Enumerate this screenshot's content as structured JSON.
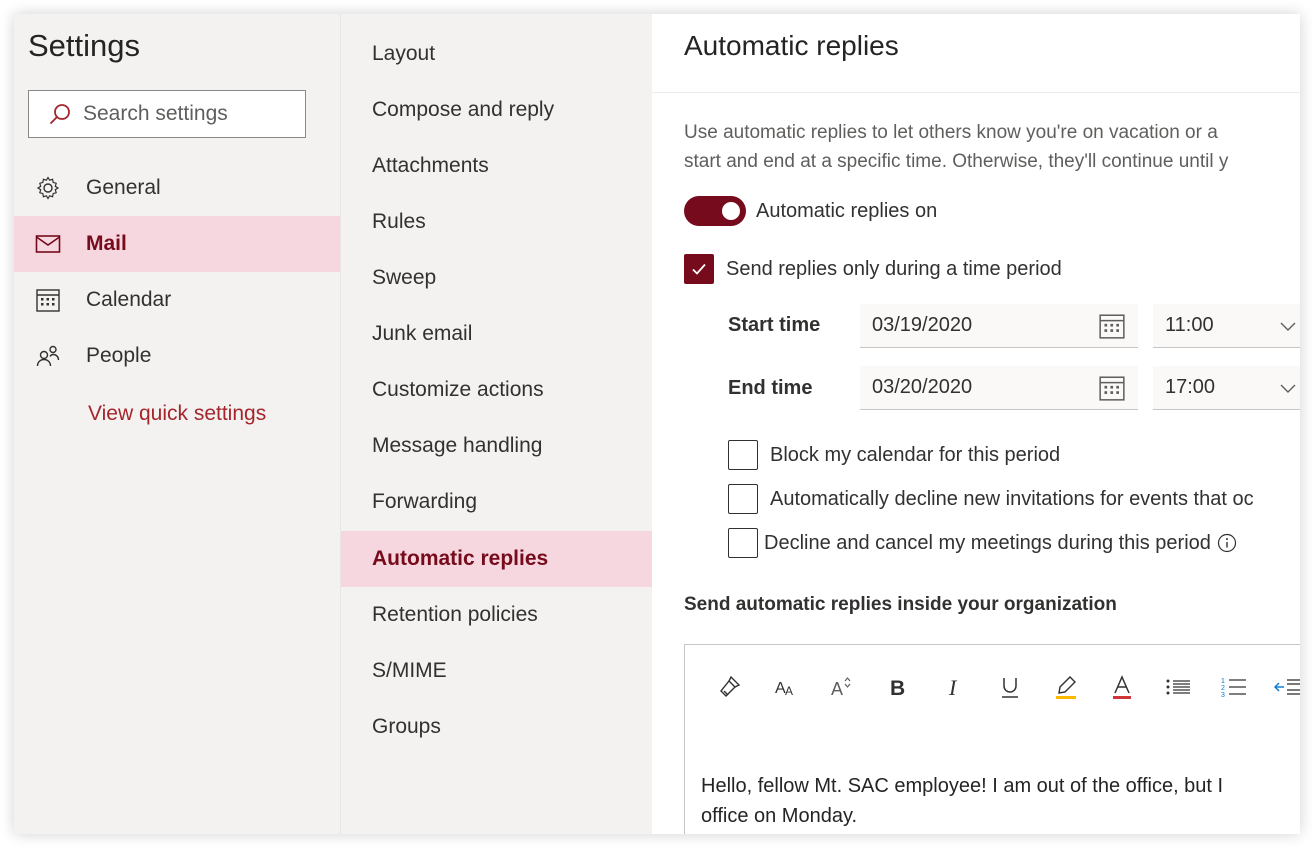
{
  "settings": {
    "title": "Settings",
    "search_placeholder": "Search settings",
    "nav": [
      {
        "label": "General",
        "icon": "gear-icon"
      },
      {
        "label": "Mail",
        "icon": "mail-icon",
        "active": true
      },
      {
        "label": "Calendar",
        "icon": "calendar-icon"
      },
      {
        "label": "People",
        "icon": "people-icon"
      }
    ],
    "quick_settings_link": "View quick settings"
  },
  "mail_menu": {
    "items": [
      "Layout",
      "Compose and reply",
      "Attachments",
      "Rules",
      "Sweep",
      "Junk email",
      "Customize actions",
      "Message handling",
      "Forwarding",
      "Automatic replies",
      "Retention policies",
      "S/MIME",
      "Groups"
    ],
    "active": "Automatic replies"
  },
  "auto_replies": {
    "title": "Automatic replies",
    "description_line1": "Use automatic replies to let others know you're on vacation or a",
    "description_line2": "start and end at a specific time. Otherwise, they'll continue until y",
    "toggle_label": "Automatic replies on",
    "toggle_on": true,
    "time_period_label": "Send replies only during a time period",
    "time_period_checked": true,
    "start_label": "Start time",
    "start_date": "03/19/2020",
    "start_time": "11:00",
    "end_label": "End time",
    "end_date": "03/20/2020",
    "end_time": "17:00",
    "options": [
      {
        "label": "Block my calendar for this period",
        "checked": false
      },
      {
        "label": "Automatically decline new invitations for events that oc",
        "checked": false
      },
      {
        "label": "Decline and cancel my meetings during this period",
        "checked": false
      }
    ],
    "inside_org_title": "Send automatic replies inside your organization",
    "toolbar_icons": [
      "format-painter-icon",
      "font-size-icon",
      "grow-font-icon",
      "bold-icon",
      "italic-icon",
      "underline-icon",
      "highlight-icon",
      "font-color-icon",
      "bullets-icon",
      "numbering-icon",
      "decrease-indent-icon"
    ],
    "message_line1": "Hello, fellow Mt. SAC employee! I am out of the office, but I",
    "message_line2": "office on Monday."
  },
  "colors": {
    "accent": "#750b1c",
    "active_bg": "#f6d7df",
    "pane_bg": "#f3f2f1",
    "link": "#a4262c"
  }
}
